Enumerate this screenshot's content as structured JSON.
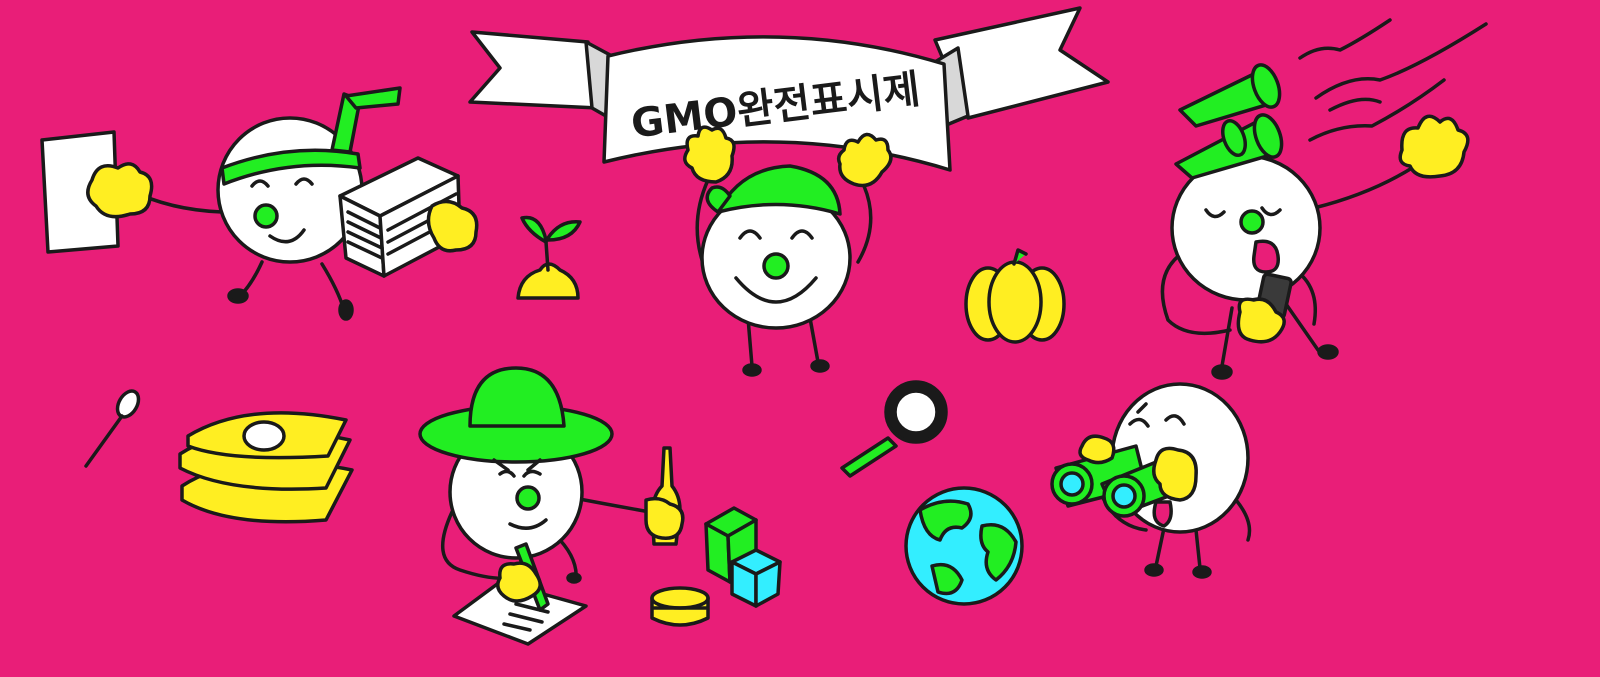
{
  "banner": {
    "text": "GMO완전표시제"
  },
  "colors": {
    "background": "#e91e78",
    "green": "#22ee22",
    "yellow": "#ffee22",
    "cyan": "#33eeff",
    "ink": "#1a1a1a",
    "white": "#ffffff"
  },
  "icons": [
    "paper-sheet-icon",
    "paper-stack-icon",
    "sprout-icon",
    "pumpkin-icon",
    "megaphone-icon",
    "phone-icon",
    "spoon-icon",
    "tofu-stack-icon",
    "bottle-icon",
    "pencil-icon",
    "milk-carton-icon",
    "cube-box-icon",
    "can-icon",
    "magnifier-icon",
    "globe-icon",
    "binoculars-icon"
  ]
}
